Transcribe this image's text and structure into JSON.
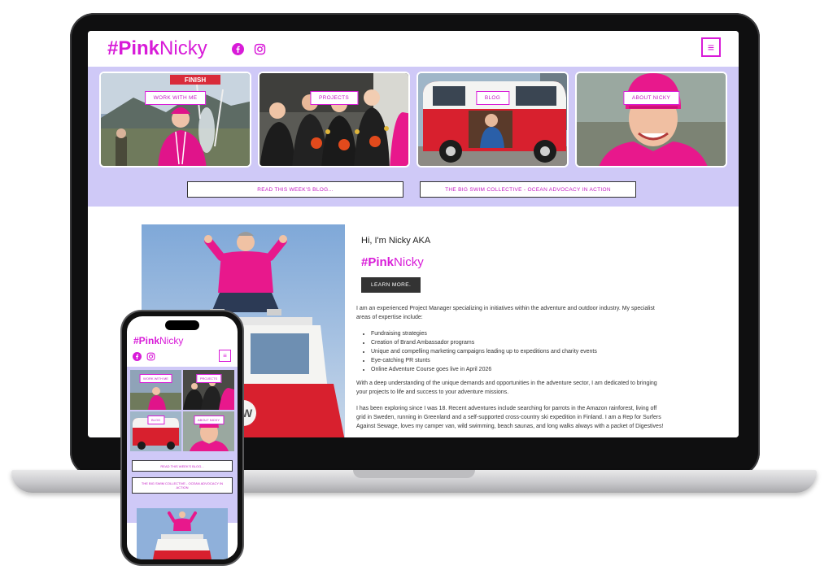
{
  "site": {
    "logo_bold": "#Pink",
    "logo_regular": "Nicky",
    "social_icons": [
      "facebook-icon",
      "instagram-icon"
    ],
    "menu_icon": "≡"
  },
  "hero": {
    "tiles": [
      {
        "label": "WORK WITH ME",
        "badge": "FINISH"
      },
      {
        "label": "PROJECTS"
      },
      {
        "label": "BLOG"
      },
      {
        "label": "ABOUT NICKY"
      }
    ],
    "links": [
      {
        "label": "READ THIS WEEK'S BLOG..."
      },
      {
        "label": "THE BIG SWIM COLLECTIVE - OCEAN ADVOCACY IN ACTION"
      }
    ]
  },
  "intro": {
    "greeting": "Hi, I'm Nicky AKA",
    "tagline_bold": "#Pink",
    "tagline_regular": "Nicky",
    "button": "LEARN MORE.",
    "paragraph_1": "I am an experienced Project Manager specializing in initiatives within the adventure and outdoor industry. My specialist areas of expertise include:",
    "bullets": [
      "Fundraising strategies",
      "Creation of Brand Ambassador programs",
      "Unique and compelling marketing campaigns leading up to expeditions and charity events",
      "Eye-catching PR stunts",
      "Online Adventure Course goes live in April 2026"
    ],
    "paragraph_2": "With a deep understanding of the unique demands and opportunities in the adventure sector, I am dedicated to bringing your projects to life and success to your adventure missions.",
    "paragraph_3": "I has been exploring since I was 18. Recent adventures include searching for parrots in the Amazon rainforest, living off grid in Sweden, running in Greenland and a self-supported cross-country ski expedition in Finland. I am a Rep for Surfers Against Sewage, loves my camper van, wild swimming, beach saunas, and long walks always with a packet of Digestives!"
  },
  "colors": {
    "brand_pink": "#d81bd8",
    "hero_lavender": "#cfc9f7",
    "button_dark": "#333333"
  }
}
